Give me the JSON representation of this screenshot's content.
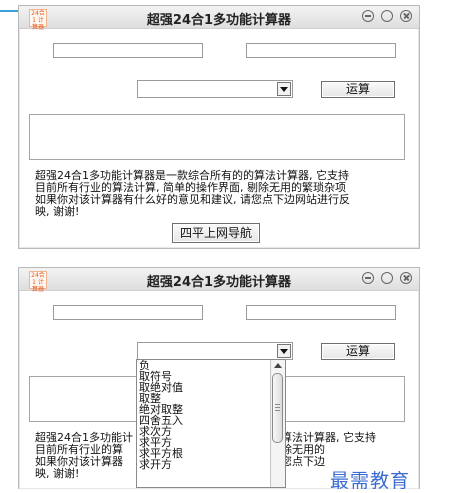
{
  "window": {
    "icon_text": "24合1 计算器",
    "title": "超强24合1多功能计算器"
  },
  "form": {
    "input1_value": "",
    "input2_value": "",
    "operation_selected": "",
    "calc_button": "运算",
    "result_value": ""
  },
  "description": {
    "lines": [
      "超强24合1多功能计算器是一款综合所有的的算法计算器, 它支持",
      "目前所有行业的算法计算, 简单的操作界面, 剔除无用的繁琐杂项",
      "如果你对该计算器有什么好的意见和建议, 请您点下边网站进行反",
      "映, 谢谢!"
    ],
    "link_button": "四平上网导航"
  },
  "window2": {
    "title": "超强24合1多功能计算器",
    "calc_button": "运算",
    "desc_lines_visible": [
      "超强24合1多功能计",
      "目前所有行业的算",
      "如果你对该计算器",
      "映, 谢谢!"
    ],
    "desc_lines_right": [
      "算法计算器, 它支持",
      "除无用的",
      "您点下边"
    ]
  },
  "dropdown": {
    "options": [
      "负",
      "取符号",
      "取绝对值",
      "取整",
      "绝对取整",
      "四舍五入",
      "求次方",
      "求平方",
      "求平方根",
      "求开方"
    ]
  },
  "watermark": "最需教育",
  "colors": {
    "accent": "#3aa0d8",
    "watermark": "#3b6cd1"
  }
}
